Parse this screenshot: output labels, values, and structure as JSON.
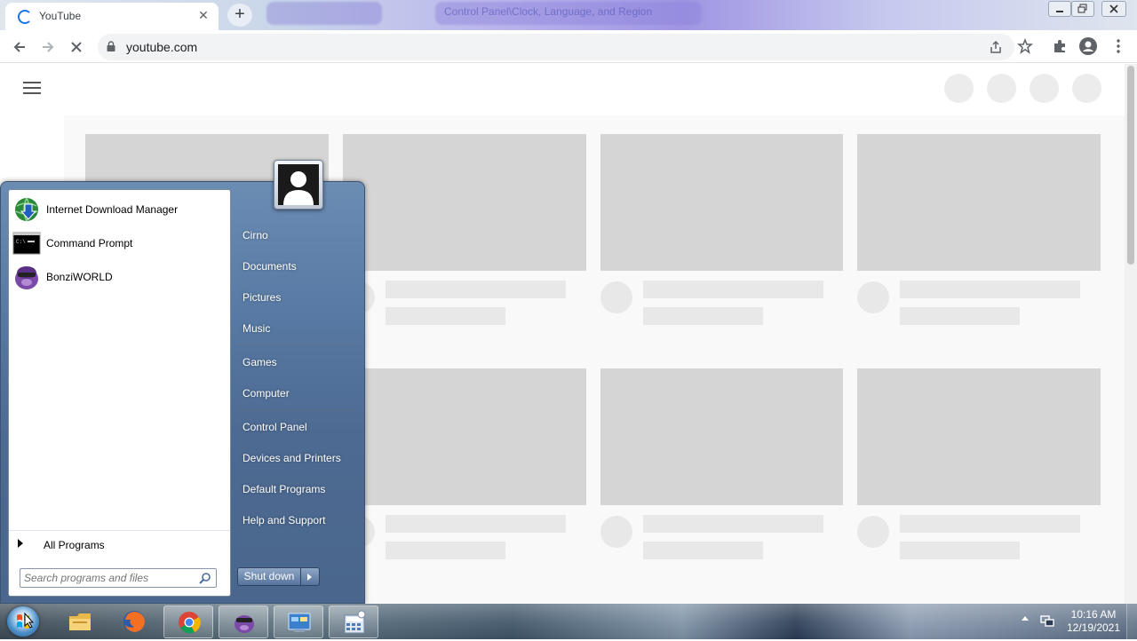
{
  "browser": {
    "tab_title": "YouTube",
    "tab_close": "✕",
    "new_tab": "+",
    "background_tab_text": "Control Panel\\Clock, Language, and Region",
    "url": "youtube.com",
    "window_controls": [
      "minimize",
      "restore",
      "close"
    ]
  },
  "start_menu": {
    "pinned": [
      {
        "label": "Internet Download Manager",
        "icon": "idm-globe-icon"
      },
      {
        "label": "Command Prompt",
        "icon": "cmd-icon"
      },
      {
        "label": "BonziWORLD",
        "icon": "bonzi-icon"
      }
    ],
    "all_programs": "All Programs",
    "search_placeholder": "Search programs and files",
    "right_links_group1": [
      "Cirno",
      "Documents",
      "Pictures",
      "Music"
    ],
    "right_links_group2": [
      "Games",
      "Computer"
    ],
    "right_links_group3": [
      "Control Panel",
      "Devices and Printers",
      "Default Programs",
      "Help and Support"
    ],
    "shutdown_label": "Shut down"
  },
  "taskbar": {
    "apps": [
      "file-explorer-icon",
      "firefox-icon",
      "chrome-icon",
      "bonzi-icon",
      "control-panel-icon",
      "calculator-icon"
    ],
    "time": "10:16 AM",
    "date": "12/19/2021"
  },
  "colors": {
    "chrome_accent": "#1a73e8",
    "skeleton_thumb": "#d5d5d5",
    "skeleton_line": "#e8e8e8",
    "start_menu_blue": "#587aa4"
  }
}
